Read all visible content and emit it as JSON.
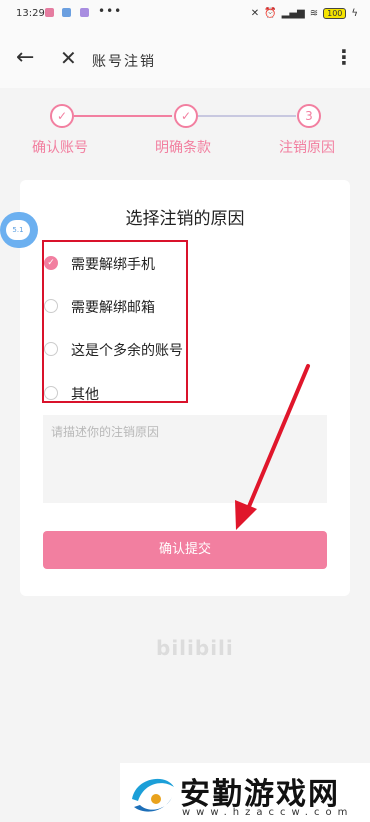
{
  "status_bar": {
    "time": "13:29",
    "dots": "•••",
    "battery": "100"
  },
  "toolbar": {
    "title": "账号注销"
  },
  "steps": [
    {
      "label": "确认账号",
      "done": true
    },
    {
      "label": "明确条款",
      "done": true
    },
    {
      "label": "注销原因",
      "number": "3"
    }
  ],
  "card": {
    "title": "选择注销的原因",
    "options": [
      {
        "label": "需要解绑手机",
        "checked": true
      },
      {
        "label": "需要解绑邮箱",
        "checked": false
      },
      {
        "label": "这是个多余的账号",
        "checked": false
      },
      {
        "label": "其他",
        "checked": false
      }
    ],
    "textarea_placeholder": "请描述你的注销原因",
    "submit_label": "确认提交"
  },
  "float_badge": "5.1",
  "brand_logo": "bilibili",
  "watermark": {
    "title": "安勤游戏网",
    "url": "www.hzaccw.com"
  },
  "colors": {
    "accent": "#f27fa0",
    "annotation": "#d9122b",
    "step_inactive": "#c8c8e0"
  }
}
